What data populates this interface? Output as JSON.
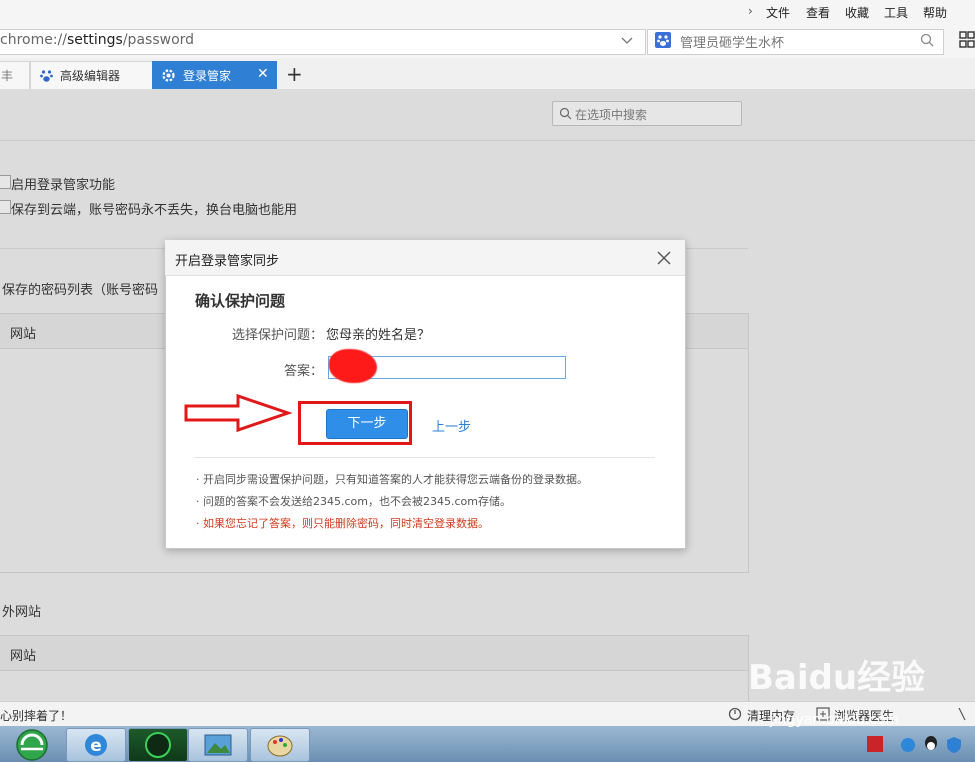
{
  "menu": [
    "文件",
    "查看",
    "收藏",
    "工具",
    "帮助"
  ],
  "address": {
    "prefix": "chrome://",
    "host": "settings",
    "path": "/password"
  },
  "search": {
    "placeholder": "管理员砸学生水杯"
  },
  "tabs": [
    {
      "label": "丰"
    },
    {
      "label": "高级编辑器"
    },
    {
      "label": "登录管家",
      "active": true
    }
  ],
  "content": {
    "search_placeholder": "在选项中搜索",
    "opt1": "启用登录管家功能",
    "opt2": "保存到云端，账号密码永不丢失，换台电脑也能用",
    "saved_title": "保存的密码列表（账号密码",
    "col_site": "网站",
    "except_title": "外网站",
    "col_site2": "网站"
  },
  "dialog": {
    "title": "开启登录管家同步",
    "heading": "确认保护问题",
    "q_label": "选择保护问题：",
    "q_value": "您母亲的姓名是？",
    "answer_label": "答案：",
    "next": "下一步",
    "prev": "上一步",
    "notes": [
      "· 开启同步需设置保护问题，只有知道答案的人才能获得您云端备份的登录数据。",
      "· 问题的答案不会发送给2345.com，也不会被2345.com存储。",
      "· 如果您忘记了答案，则只能删除密码，同时清空登录数据。"
    ]
  },
  "status": {
    "left": "心别摔着了！",
    "clean": "清理内存",
    "doctor": "浏览器医生"
  },
  "watermark": {
    "brand": "Baidu经验",
    "url": "jingyan.baidu.com"
  },
  "colors": {
    "accent": "#2f8ee8",
    "warning": "#d03a1e",
    "annotation": "#e01818"
  }
}
